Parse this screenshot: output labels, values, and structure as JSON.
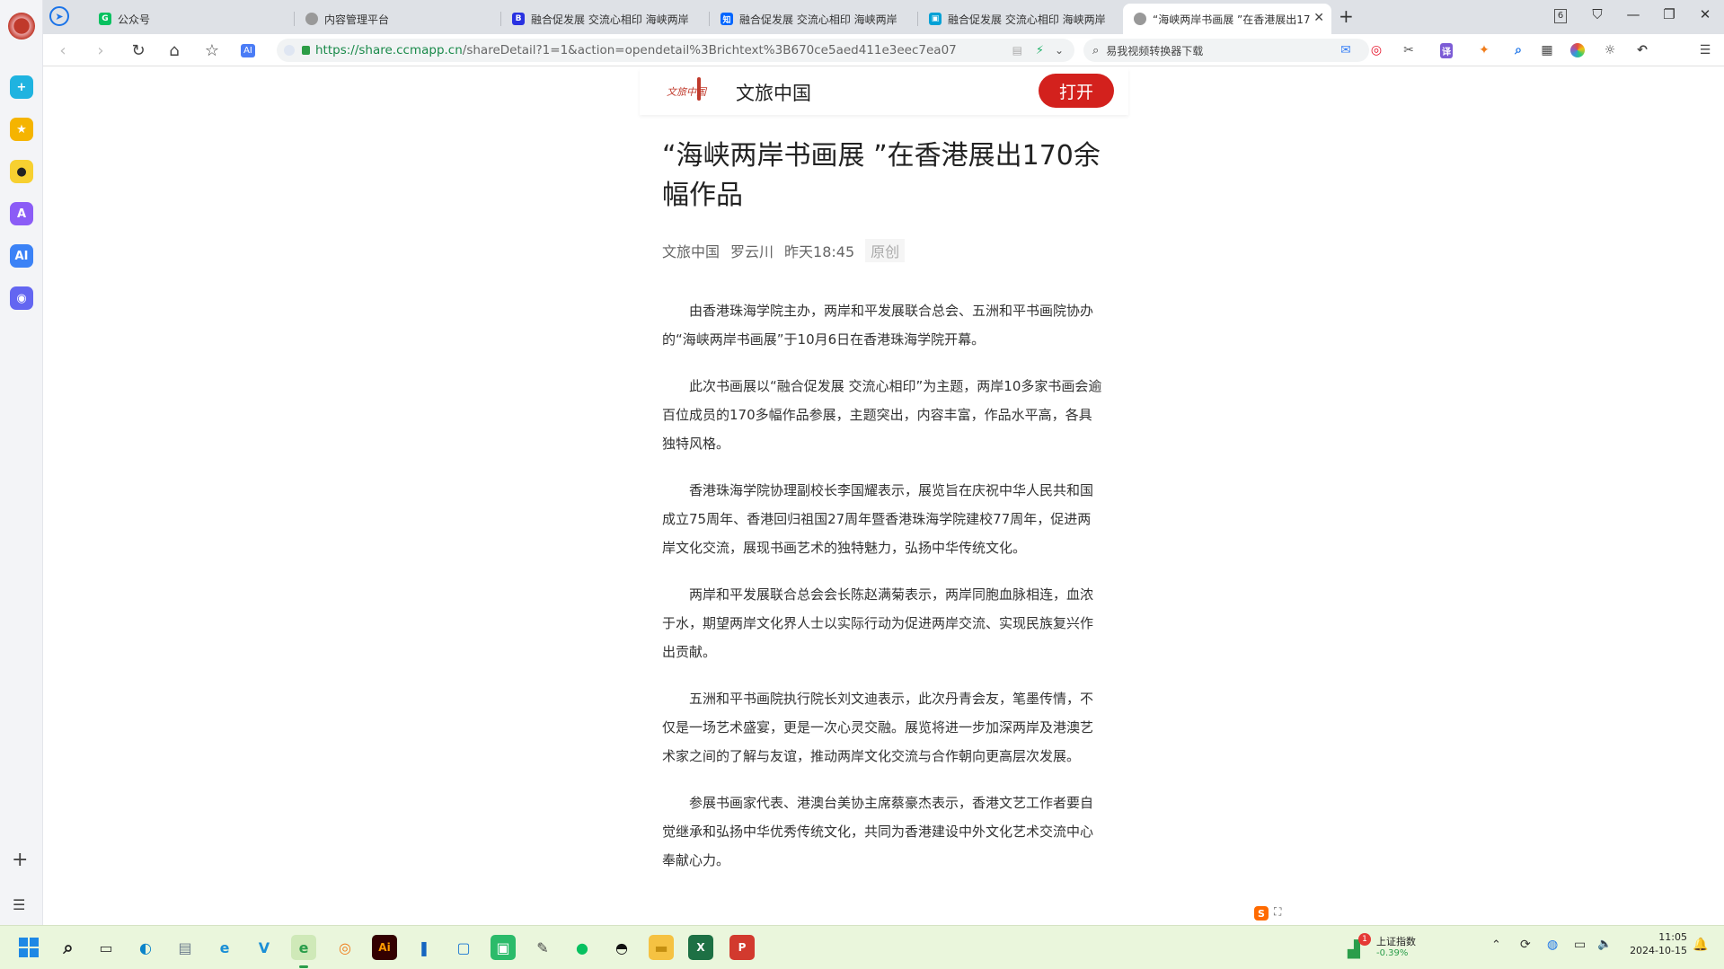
{
  "tabs": [
    {
      "label": "公众号",
      "active": false
    },
    {
      "label": "内容管理平台",
      "active": false
    },
    {
      "label": "融合促发展 交流心相印 海峡两岸",
      "active": false
    },
    {
      "label": "融合促发展 交流心相印 海峡两岸",
      "active": false
    },
    {
      "label": "融合促发展 交流心相印 海峡两岸",
      "active": false
    },
    {
      "label": "“海峡两岸书画展 ”在香港展出17",
      "active": true
    }
  ],
  "tab_count_badge": "6",
  "address": {
    "scheme": "https://",
    "domain": "share.ccmapp.cn",
    "path": "/shareDetail?1=1&action=opendetail%3Brichtext%3B670ce5aed411e3eec7ea07"
  },
  "search": {
    "placeholder": "易我视频转换器下载"
  },
  "site": {
    "name": "文旅中国",
    "logo_text": "文旅中国",
    "open_label": "打开"
  },
  "article": {
    "title": "“海峡两岸书画展 ”在香港展出170余幅作品",
    "source": "文旅中国",
    "author": "罗云川",
    "time": "昨天18:45",
    "badge": "原创",
    "paragraphs": [
      "由香港珠海学院主办，两岸和平发展联合总会、五洲和平书画院协办的“海峡两岸书画展”于10月6日在香港珠海学院开幕。",
      "此次书画展以“融合促发展 交流心相印”为主题，两岸10多家书画会逾百位成员的170多幅作品参展，主题突出，内容丰富，作品水平高，各具独特风格。",
      "香港珠海学院协理副校长李国耀表示，展览旨在庆祝中华人民共和国成立75周年、香港回归祖国27周年暨香港珠海学院建校77周年，促进两岸文化交流，展现书画艺术的独特魅力，弘扬中华传统文化。",
      "两岸和平发展联合总会会长陈赵满菊表示，两岸同胞血脉相连，血浓于水，期望两岸文化界人士以实际行动为促进两岸交流、实现民族复兴作出贡献。",
      "五洲和平书画院执行院长刘文迪表示，此次丹青会友，笔墨传情，不仅是一场艺术盛宴，更是一次心灵交融。展览将进一步加深两岸及港澳艺术家之间的了解与友谊，推动两岸文化交流与合作朝向更高层次发展。",
      "参展书画家代表、港澳台美协主席蔡豪杰表示，香港文艺工作者要自觉继承和弘扬中华优秀传统文化，共同为香港建设中外文化艺术交流中心奉献心力。"
    ]
  },
  "taskbar": {
    "stock_name": "上证指数",
    "stock_change": "-0.39%",
    "stock_badge": "1",
    "time": "11:05",
    "date": "2024-10-15"
  },
  "colors": {
    "accent": "#d3211d",
    "tabbar": "#dee1e6",
    "taskbar": "#eaf6dc",
    "link_green": "#1a8a4a"
  }
}
